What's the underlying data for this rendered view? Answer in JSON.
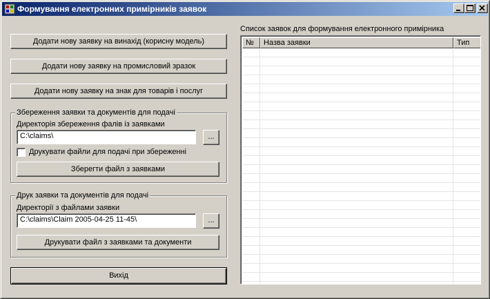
{
  "window": {
    "title": "Формування електронних примірників заявок"
  },
  "buttons": {
    "add_invention": "Додати нову заявку на винахід (корисну модель)",
    "add_design": "Додати нову заявку на промисловий зразок",
    "add_trademark": "Додати нову заявку на знак для товарів і послуг",
    "exit": "Вихід"
  },
  "save_group": {
    "legend": "Збереження заявки та документів для подачі",
    "dir_label": "Директорія збереження фалів із заявками",
    "dir_value": "C:\\claims\\",
    "browse_label": "...",
    "print_on_save_label": "Друкувати файли для подачі при збереженні",
    "print_on_save_checked": false,
    "save_button": "Зберегти файл з заявками"
  },
  "print_group": {
    "legend": "Друк заявки та документів для подачі",
    "dir_label": "Директорії з файлами заявки",
    "dir_value": "C:\\claims\\Claim 2005-04-25 11-45\\",
    "browse_label": "...",
    "print_button": "Друкувати файл з заявками та документи"
  },
  "claims_list": {
    "title": "Список заявок для формування електронного примірника",
    "columns": [
      "№",
      "Назва заявки",
      "Тип"
    ],
    "rows": []
  }
}
